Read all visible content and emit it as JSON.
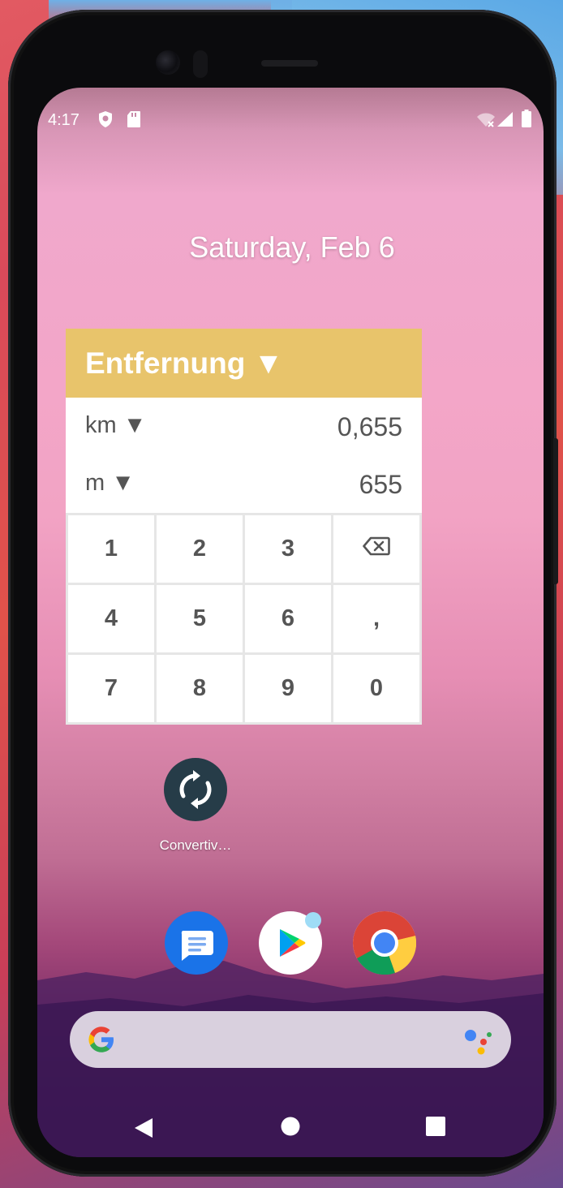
{
  "status_bar": {
    "time": "4:17",
    "icons": [
      "shield-icon",
      "sd-card-icon",
      "wifi-off-icon",
      "signal-icon",
      "battery-icon"
    ]
  },
  "home": {
    "date": "Saturday, Feb 6"
  },
  "widget": {
    "title": "Entfernung ▼",
    "rows": [
      {
        "unit": "km ▼",
        "value": "0,655"
      },
      {
        "unit": "m ▼",
        "value": "655"
      }
    ],
    "keys": [
      "1",
      "2",
      "3",
      "⌫",
      "4",
      "5",
      "6",
      ",",
      "7",
      "8",
      "9",
      "0"
    ],
    "header_color": "#e8c46b"
  },
  "apps": {
    "convertiv_label": "Convertiv…",
    "dock": [
      "messages-icon",
      "play-store-icon",
      "chrome-icon"
    ]
  },
  "search": {
    "icons": [
      "google-g-icon",
      "assistant-icon"
    ]
  },
  "nav": {
    "buttons": [
      "back-button",
      "home-button",
      "recents-button"
    ]
  }
}
